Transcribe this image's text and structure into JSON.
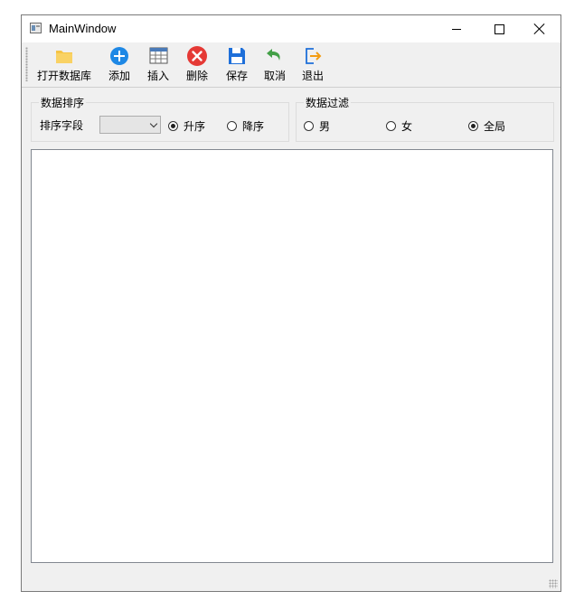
{
  "window": {
    "title": "MainWindow"
  },
  "toolbar": {
    "items": [
      {
        "label": "打开数据库",
        "icon": "folder-icon"
      },
      {
        "label": "添加",
        "icon": "add-icon"
      },
      {
        "label": "插入",
        "icon": "table-insert-icon"
      },
      {
        "label": "删除",
        "icon": "delete-icon"
      },
      {
        "label": "保存",
        "icon": "save-icon"
      },
      {
        "label": "取消",
        "icon": "undo-icon"
      },
      {
        "label": "退出",
        "icon": "exit-icon"
      }
    ]
  },
  "sort_group": {
    "title": "数据排序",
    "field_label": "排序字段",
    "field_value": "",
    "ascending_label": "升序",
    "descending_label": "降序",
    "selected": "ascending"
  },
  "filter_group": {
    "title": "数据过滤",
    "male_label": "男",
    "female_label": "女",
    "all_label": "全局",
    "selected": "all"
  },
  "colors": {
    "window_bg": "#f0f0f0",
    "add_blue": "#1e88e5",
    "delete_red": "#e53935",
    "save_blue": "#1e6fd9",
    "undo_green": "#43a047",
    "exit_orange": "#f39c12",
    "folder_yellow": "#f6c444"
  }
}
